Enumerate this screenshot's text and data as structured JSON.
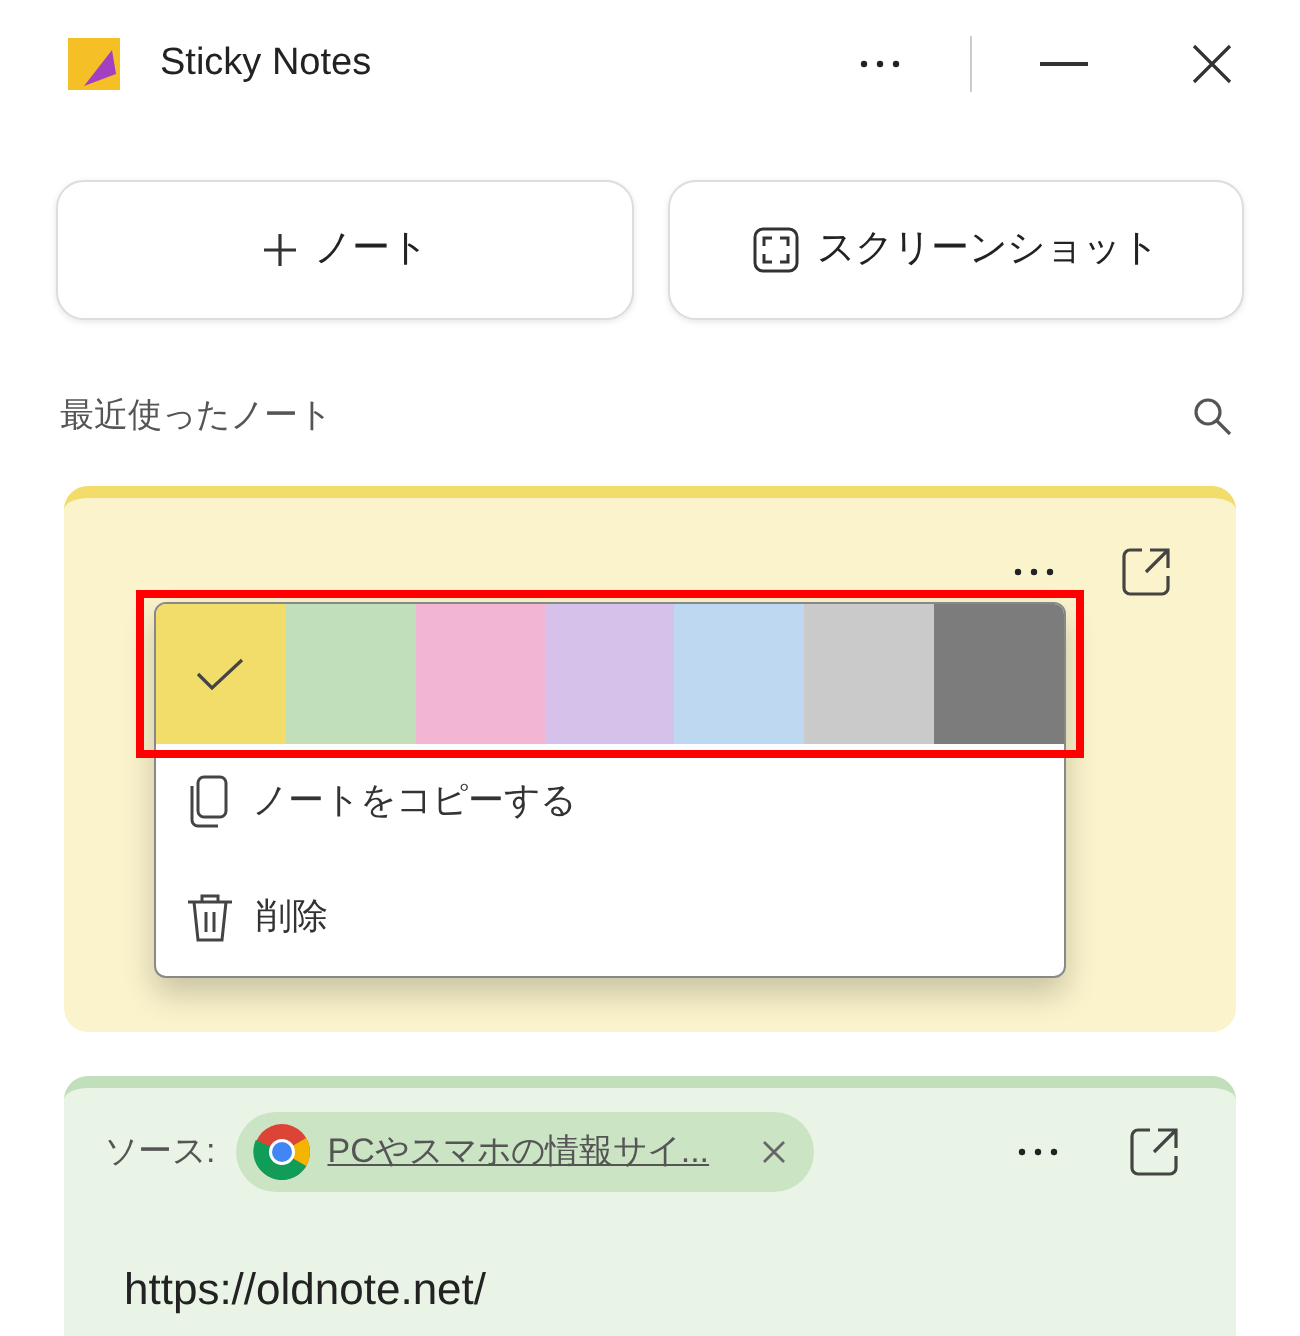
{
  "window": {
    "title": "Sticky Notes"
  },
  "actions": [
    {
      "kind": "new",
      "label": "ノート"
    },
    {
      "kind": "screenshot",
      "label": "スクリーンショット"
    }
  ],
  "section": {
    "title": "最近使ったノート"
  },
  "notes": [
    {
      "color": "#f2dc6a",
      "menu": {
        "colors": [
          {
            "color": "#f2dc6a",
            "selected": true
          },
          {
            "color": "#c1dfba",
            "selected": false
          },
          {
            "color": "#f2b5d2",
            "selected": false
          },
          {
            "color": "#d6c1ea",
            "selected": false
          },
          {
            "color": "#bfd8f2",
            "selected": false
          },
          {
            "color": "#cacaca",
            "selected": false
          },
          {
            "color": "#7c7c7c",
            "selected": false
          }
        ],
        "items": [
          {
            "kind": "copy",
            "label": "ノートをコピーする"
          },
          {
            "kind": "delete",
            "label": "削除"
          }
        ],
        "highlighted": true
      }
    },
    {
      "color": "#c1dfba",
      "source": {
        "label": "ソース:",
        "link": "PCやスマホの情報サイ..."
      },
      "text": "https://oldnote.net/"
    }
  ]
}
